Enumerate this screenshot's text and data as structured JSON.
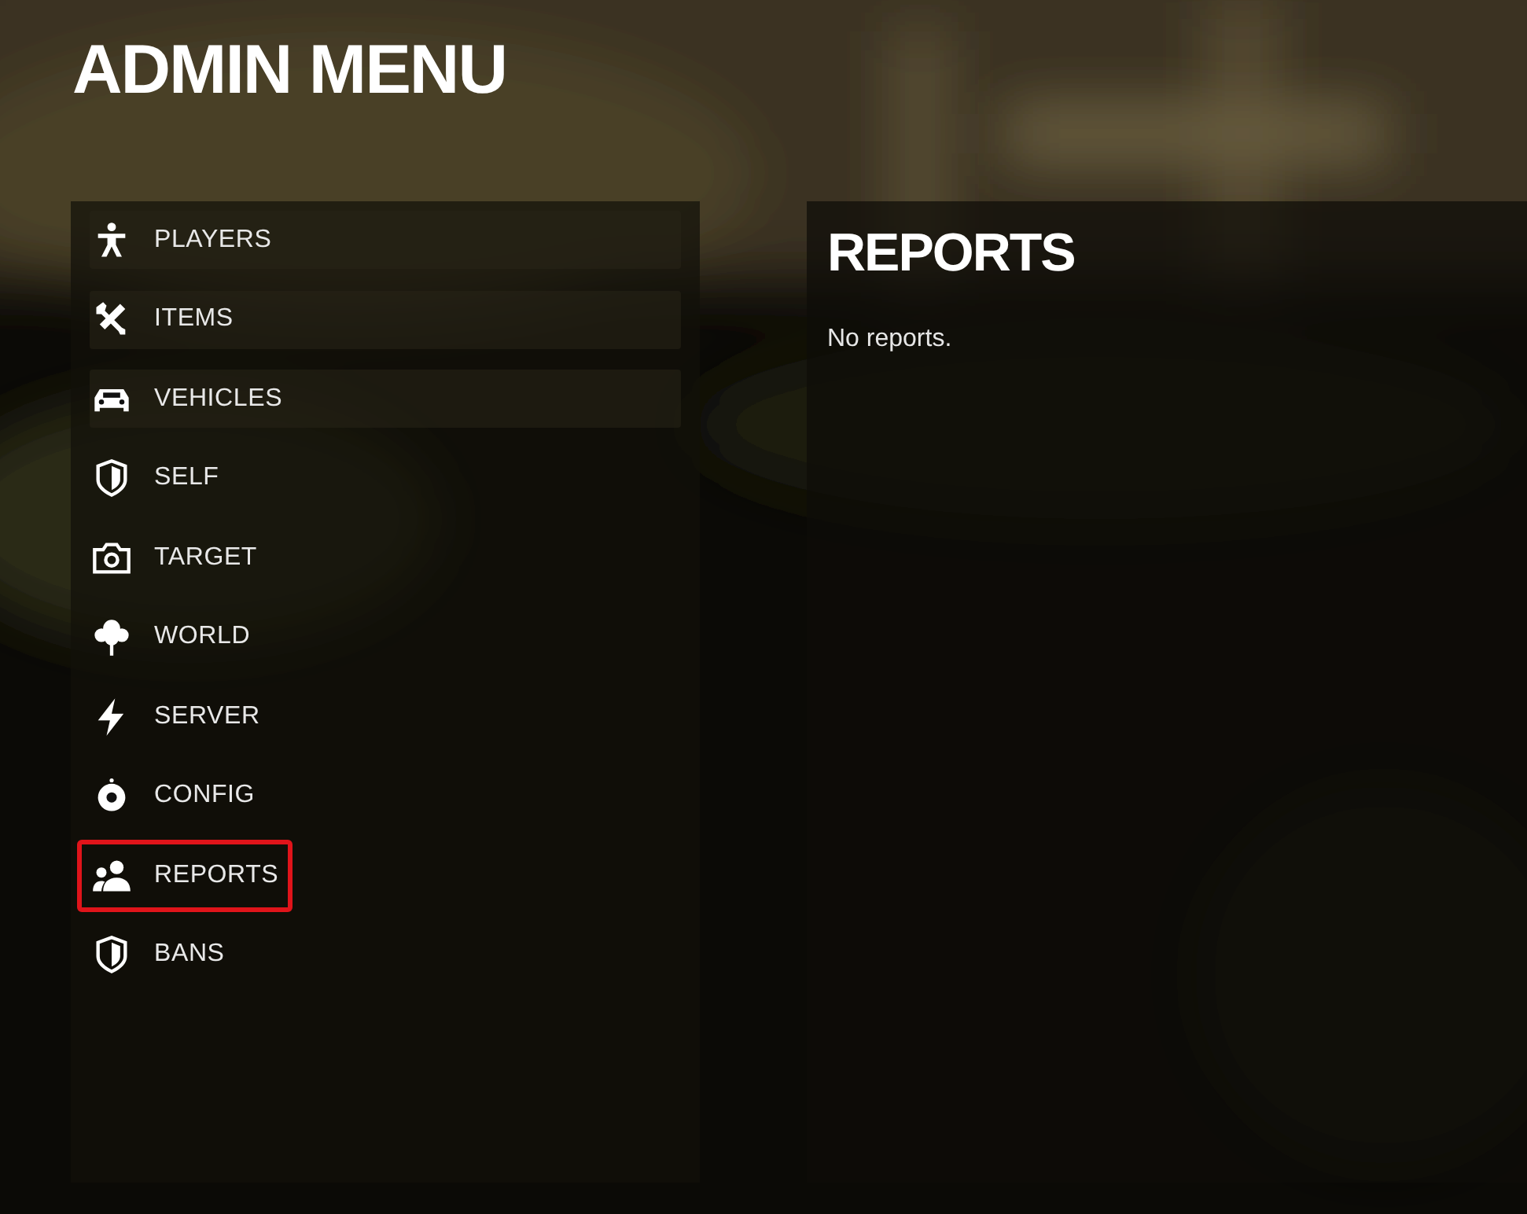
{
  "title": "ADMIN MENU",
  "sidebar": {
    "items": [
      {
        "kind": "person",
        "label": "PLAYERS",
        "shaded": true,
        "highlighted": false
      },
      {
        "kind": "tools",
        "label": "ITEMS",
        "shaded": true,
        "highlighted": false
      },
      {
        "kind": "car",
        "label": "VEHICLES",
        "shaded": true,
        "highlighted": false
      },
      {
        "kind": "shield",
        "label": "SELF",
        "shaded": false,
        "highlighted": false
      },
      {
        "kind": "camera",
        "label": "TARGET",
        "shaded": false,
        "highlighted": false
      },
      {
        "kind": "tree",
        "label": "WORLD",
        "shaded": false,
        "highlighted": false
      },
      {
        "kind": "bolt",
        "label": "SERVER",
        "shaded": false,
        "highlighted": false
      },
      {
        "kind": "gear",
        "label": "CONFIG",
        "shaded": false,
        "highlighted": false
      },
      {
        "kind": "users",
        "label": "REPORTS",
        "shaded": false,
        "highlighted": true
      },
      {
        "kind": "shield",
        "label": "BANS",
        "shaded": false,
        "highlighted": false
      }
    ]
  },
  "content": {
    "heading": "REPORTS",
    "message": "No reports."
  }
}
